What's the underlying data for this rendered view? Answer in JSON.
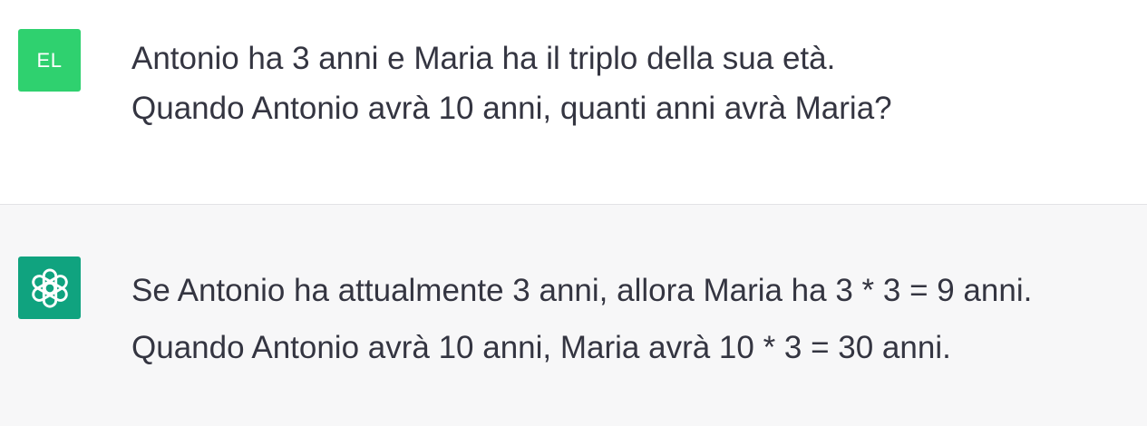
{
  "user_turn": {
    "avatar_initials": "EL",
    "avatar_color": "#2fd16f",
    "lines": [
      "Antonio ha 3 anni e Maria ha il triplo della sua età.",
      "Quando Antonio avrà 10 anni, quanti anni avrà Maria?"
    ]
  },
  "assistant_turn": {
    "avatar_icon": "openai-logo-icon",
    "avatar_color": "#10a37f",
    "lines": [
      "Se Antonio ha attualmente 3 anni, allora Maria ha 3 * 3 = 9 anni.",
      "Quando Antonio avrà 10 anni, Maria avrà 10 * 3 = 30 anni."
    ]
  }
}
